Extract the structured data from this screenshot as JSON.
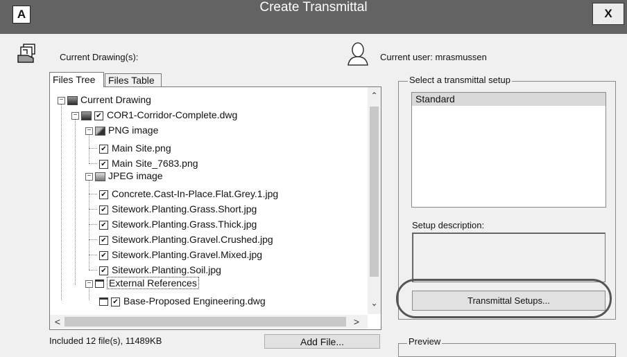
{
  "window": {
    "title": "Create Transmittal",
    "app_icon_letter": "A",
    "close_label": "X"
  },
  "header": {
    "current_drawings_label": "Current Drawing(s):",
    "current_user_label": "Current user: mrasmussen"
  },
  "tabs": [
    {
      "label": "Files Tree",
      "active": true
    },
    {
      "label": "Files Table",
      "active": false
    }
  ],
  "tree": {
    "nodes": [
      {
        "label": "Current Drawing"
      },
      {
        "label": "COR1-Corridor-Complete.dwg",
        "checked": true
      },
      {
        "label": "PNG image"
      },
      {
        "label": "Main Site.png",
        "checked": true
      },
      {
        "label": "Main Site_7683.png",
        "checked": true
      },
      {
        "label": "JPEG image"
      },
      {
        "label": "Concrete.Cast-In-Place.Flat.Grey.1.jpg",
        "checked": true
      },
      {
        "label": "Sitework.Planting.Grass.Short.jpg",
        "checked": true
      },
      {
        "label": "Sitework.Planting.Grass.Thick.jpg",
        "checked": true
      },
      {
        "label": "Sitework.Planting.Gravel.Crushed.jpg",
        "checked": true
      },
      {
        "label": "Sitework.Planting.Gravel.Mixed.jpg",
        "checked": true
      },
      {
        "label": "Sitework.Planting.Soil.jpg",
        "checked": true
      },
      {
        "label": "External References"
      },
      {
        "label": "Base-Proposed Engineering.dwg",
        "checked": true
      }
    ]
  },
  "footer": {
    "status": "Included 12 file(s), 11489KB",
    "add_file_label": "Add File..."
  },
  "setup": {
    "group_label": "Select a transmittal setup",
    "items": [
      "Standard"
    ],
    "description_label": "Setup description:",
    "setups_button": "Transmittal Setups..."
  },
  "preview": {
    "group_label": "Preview"
  },
  "icons": {
    "app": "autocad-logo-icon",
    "drawings": "drawing-stack-icon",
    "user": "user-silhouette-icon"
  }
}
